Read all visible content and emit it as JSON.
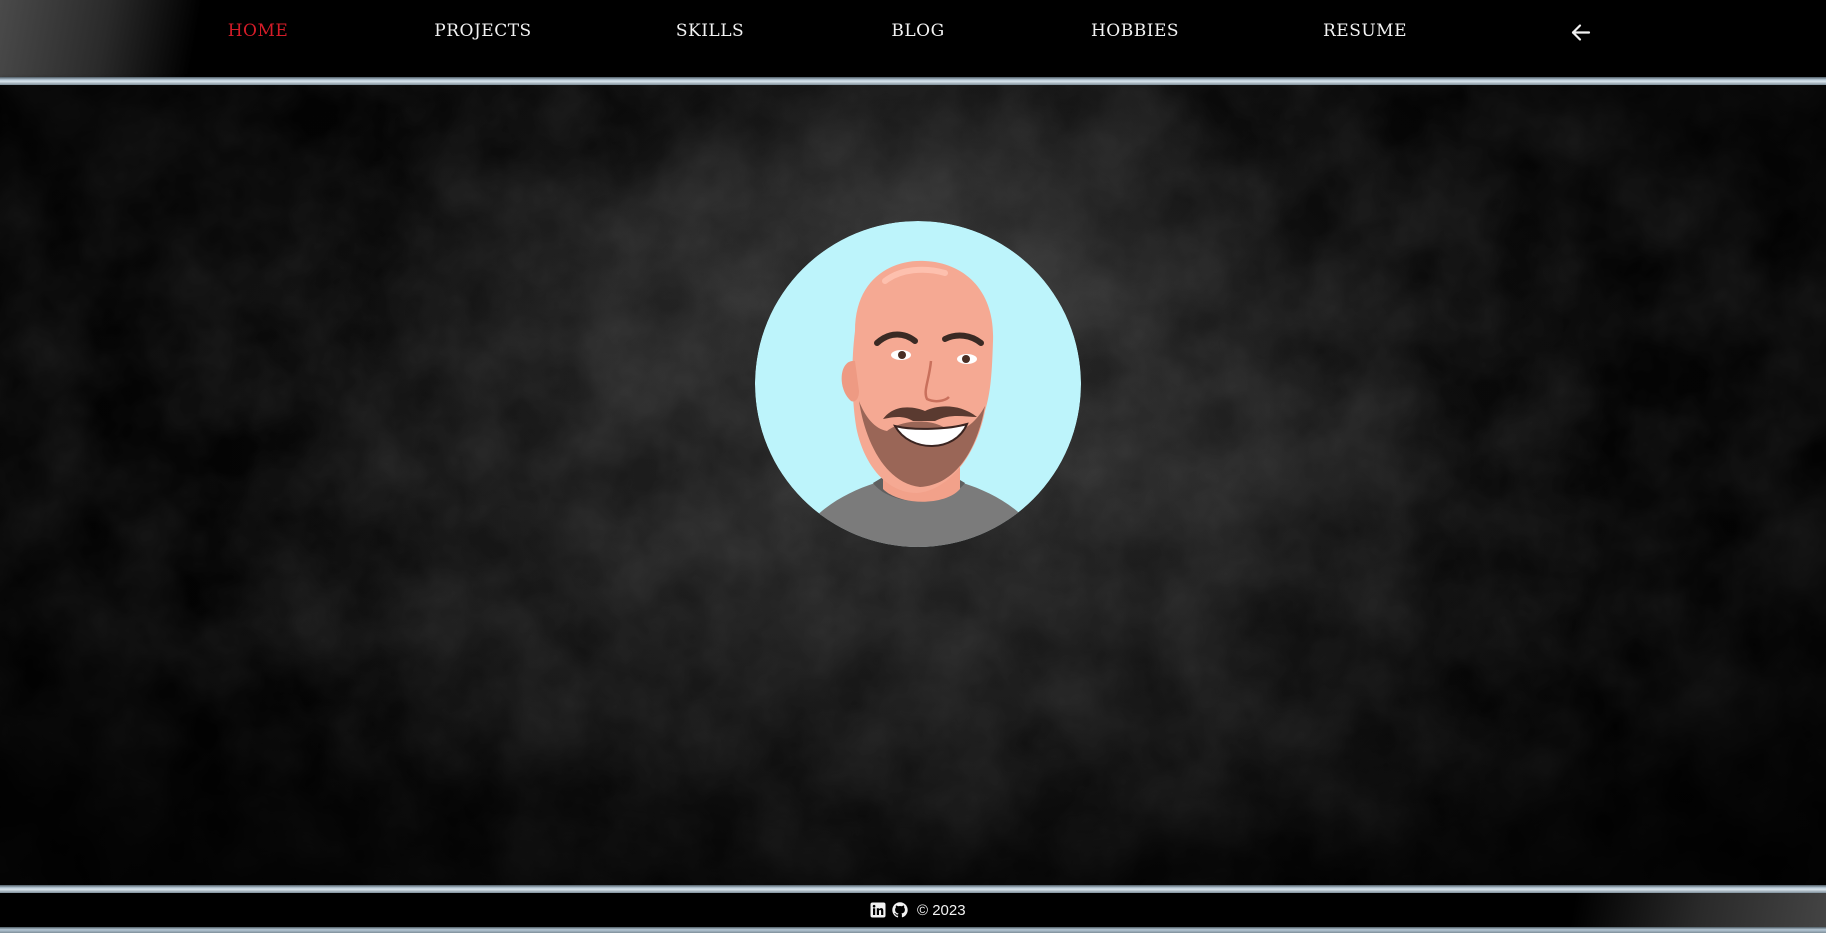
{
  "nav": {
    "items": [
      {
        "label": "HOME",
        "active": true
      },
      {
        "label": "PROJECTS",
        "active": false
      },
      {
        "label": "SKILLS",
        "active": false
      },
      {
        "label": "BLOG",
        "active": false
      },
      {
        "label": "HOBBIES",
        "active": false
      },
      {
        "label": "RESUME",
        "active": false
      }
    ],
    "back_icon": "arrow-left-icon"
  },
  "hero": {
    "avatar_icon": "cartoon-portrait-avatar",
    "avatar_bg_color": "#bdf4fb"
  },
  "footer": {
    "icons": [
      "linkedin-icon",
      "github-icon"
    ],
    "copyright": "© 2023"
  },
  "colors": {
    "nav_text": "#f2f2f2",
    "nav_active": "#d41c28",
    "rule_highlight": "#b7c9d6",
    "background": "#000000"
  }
}
